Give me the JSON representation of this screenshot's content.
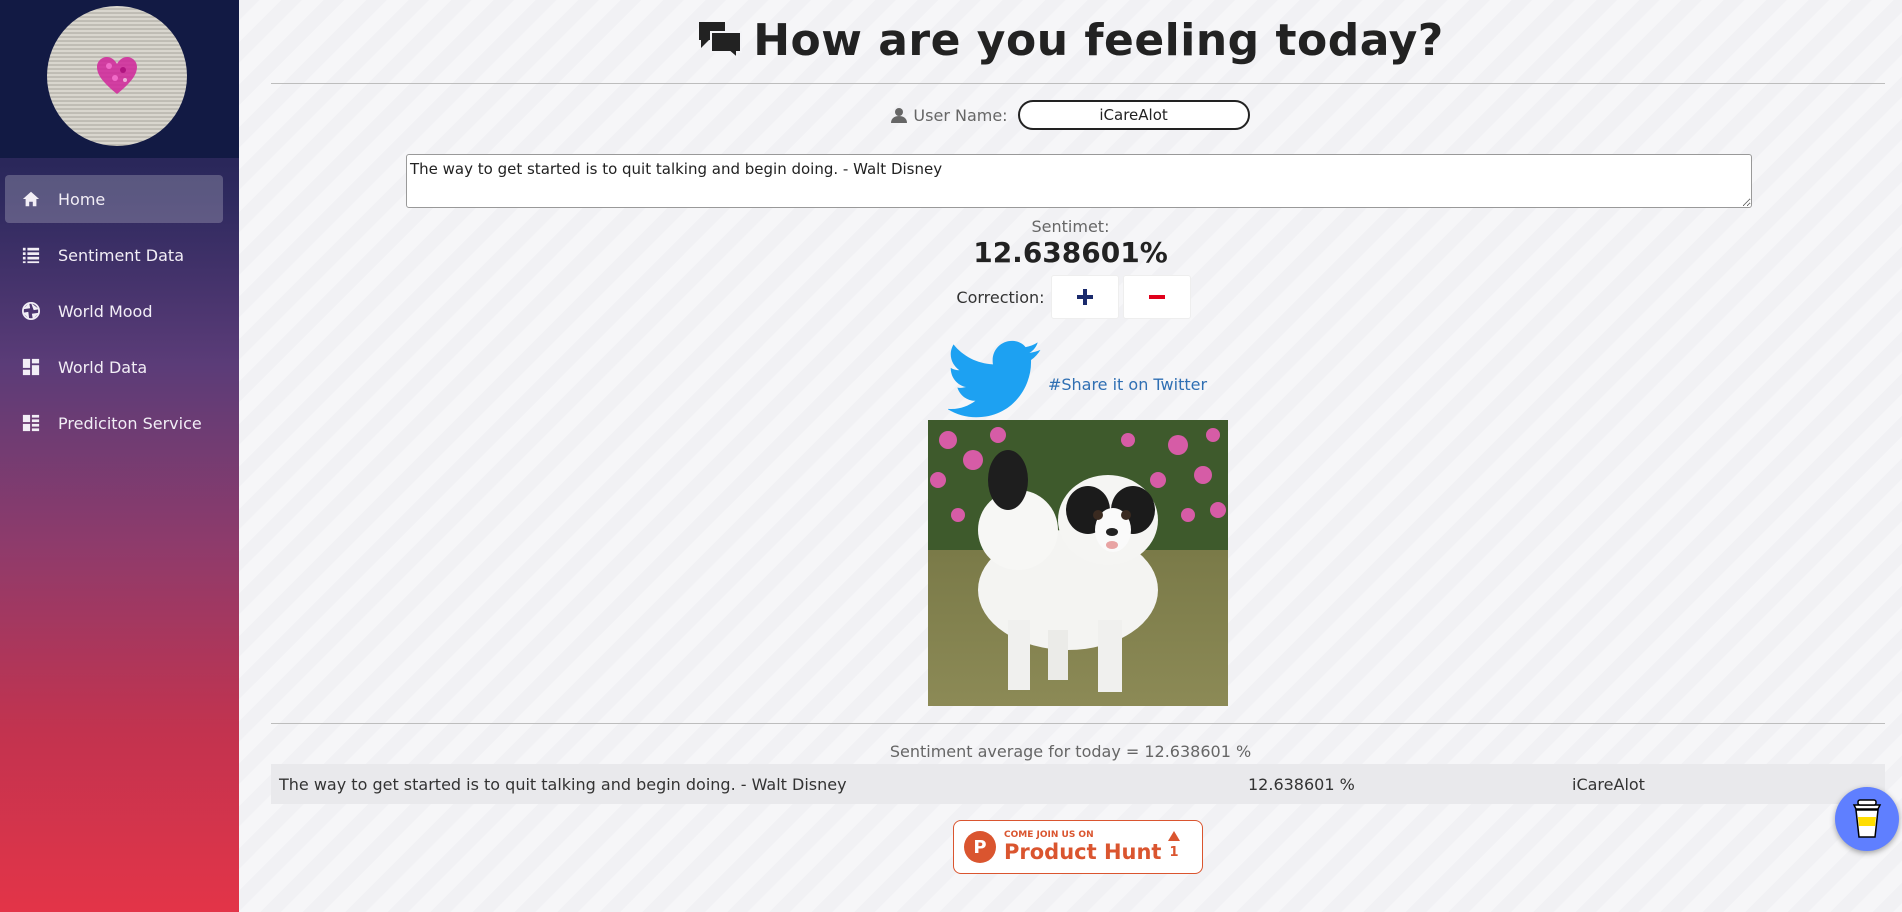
{
  "sidebar": {
    "items": [
      {
        "label": "Home",
        "icon": "home-icon",
        "active": true
      },
      {
        "label": "Sentiment Data",
        "icon": "list-icon",
        "active": false
      },
      {
        "label": "World Mood",
        "icon": "aperture-icon",
        "active": false
      },
      {
        "label": "World Data",
        "icon": "dashboard-icon",
        "active": false
      },
      {
        "label": "Prediciton Service",
        "icon": "list-dashboard-icon",
        "active": false
      }
    ]
  },
  "header": {
    "title": "How are you feeling today?"
  },
  "user": {
    "label": "User Name:",
    "value": "iCareAlot"
  },
  "quote": {
    "text": "The way to get started is to quit talking and begin doing. - Walt Disney"
  },
  "sentiment": {
    "label": "Sentimet:",
    "value": "12.638601%"
  },
  "correction": {
    "label": "Correction:",
    "plus_color": "#1a2a6c",
    "minus_color": "#e0001b"
  },
  "share": {
    "link_text": "#Share it on Twitter",
    "twitter_color": "#1da1f2"
  },
  "average": {
    "text": "Sentiment average for today = 12.638601 %"
  },
  "table": {
    "rows": [
      {
        "quote": "The way to get started is to quit talking and begin doing. - Walt Disney",
        "value": "12.638601 %",
        "user": "iCareAlot"
      }
    ]
  },
  "producthunt": {
    "small": "COME JOIN US ON",
    "big": "Product Hunt",
    "count": "1",
    "color": "#da552f"
  }
}
